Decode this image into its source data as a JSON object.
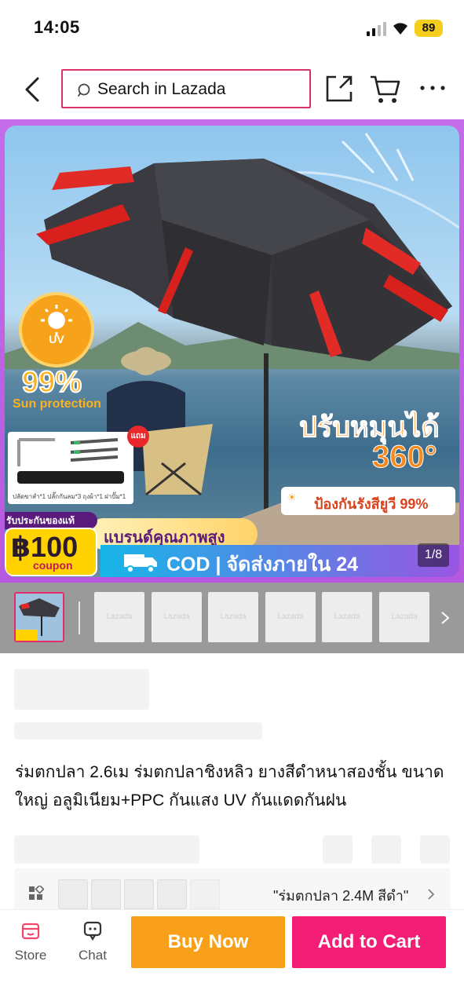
{
  "status_bar": {
    "time": "14:05",
    "battery": "89"
  },
  "header": {
    "search_placeholder": "Search in Lazada",
    "icons": [
      "back-arrow-icon",
      "search-icon",
      "share-icon",
      "cart-icon",
      "more-icon"
    ]
  },
  "hero": {
    "uv_label": "UV",
    "percent": "99%",
    "sun_protection": "Sun protection",
    "rotate_text": "ปรับหมุนได้",
    "rotate_degrees": "360°",
    "uv_protect_text": "ป้องกันรังสียูวี 99%",
    "gift_badge": "แถม",
    "parts_caption": "ปลัดขาสำ*1  ปลั๊กกันลม*3  ถุงผ้า*1  ฝาปั๊ม*1",
    "brand_text": "แบรนด์คุณภาพสูง",
    "coupon_top": "รับประกันของแท้",
    "coupon_amount": "฿100",
    "coupon_label": "coupon",
    "cod_text": "COD | จัดส่งภายใน 24",
    "counter": "1/8"
  },
  "thumbnails": {
    "placeholder_label": "Lazada",
    "count": 6
  },
  "product": {
    "title": "ร่มตกปลา 2.6เม ร่มตกปลาชิงหลิว ยางสีดำหนาสองชั้น ขนาดใหญ่ อลูมิเนียม+PPC กันแสง UV กันแดดกันฝน"
  },
  "variant": {
    "selected": "\"ร่มตกปลา 2.4M สีดำ\""
  },
  "bottom_bar": {
    "store_label": "Store",
    "chat_label": "Chat",
    "buy_now": "Buy Now",
    "add_to_cart": "Add to Cart",
    "buy_color": "#f8a019",
    "cart_color": "#f41d75"
  }
}
